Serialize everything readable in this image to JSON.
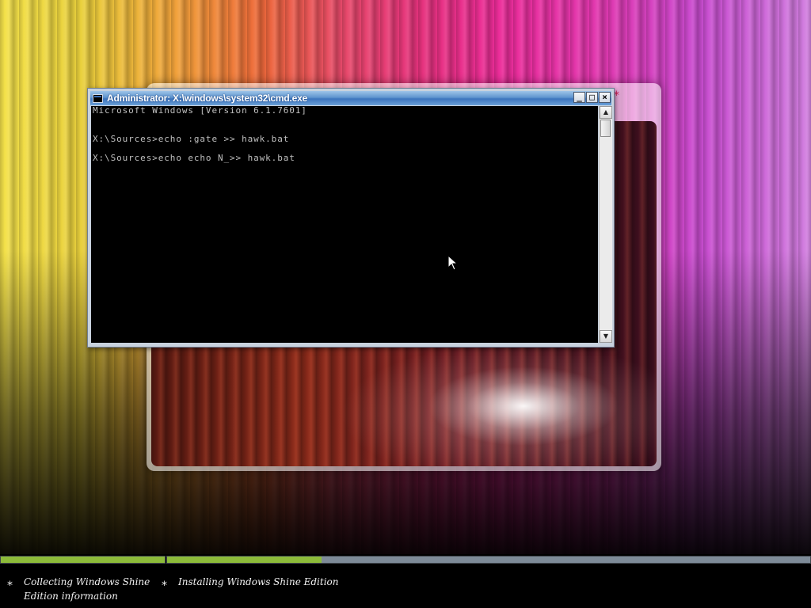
{
  "cmd_window": {
    "title": "Administrator: X:\\windows\\system32\\cmd.exe",
    "buttons": {
      "minimize": "_",
      "maximize": "□",
      "close": "×"
    },
    "console_lines": [
      "Microsoft Windows [Version 6.1.7601]",
      "X:\\Sources>echo :gate >> hawk.bat",
      "X:\\Sources>echo echo N_>> hawk.bat"
    ],
    "scroll_up_glyph": "▲",
    "scroll_down_glyph": "▼"
  },
  "installer": {
    "close_mark": "*"
  },
  "progress": {
    "segment1_fill_fraction": 1.0,
    "segment2_fill_fraction": 0.24
  },
  "status": {
    "steps": [
      {
        "bullet": "*",
        "label": "Collecting Windows Shine Edition information"
      },
      {
        "bullet": "*",
        "label": "Installing Windows Shine Edition"
      }
    ]
  },
  "colors": {
    "progress_fill": "#8dbb3a",
    "progress_track": "#7e8b98",
    "titlebar": "#3c74bd"
  }
}
